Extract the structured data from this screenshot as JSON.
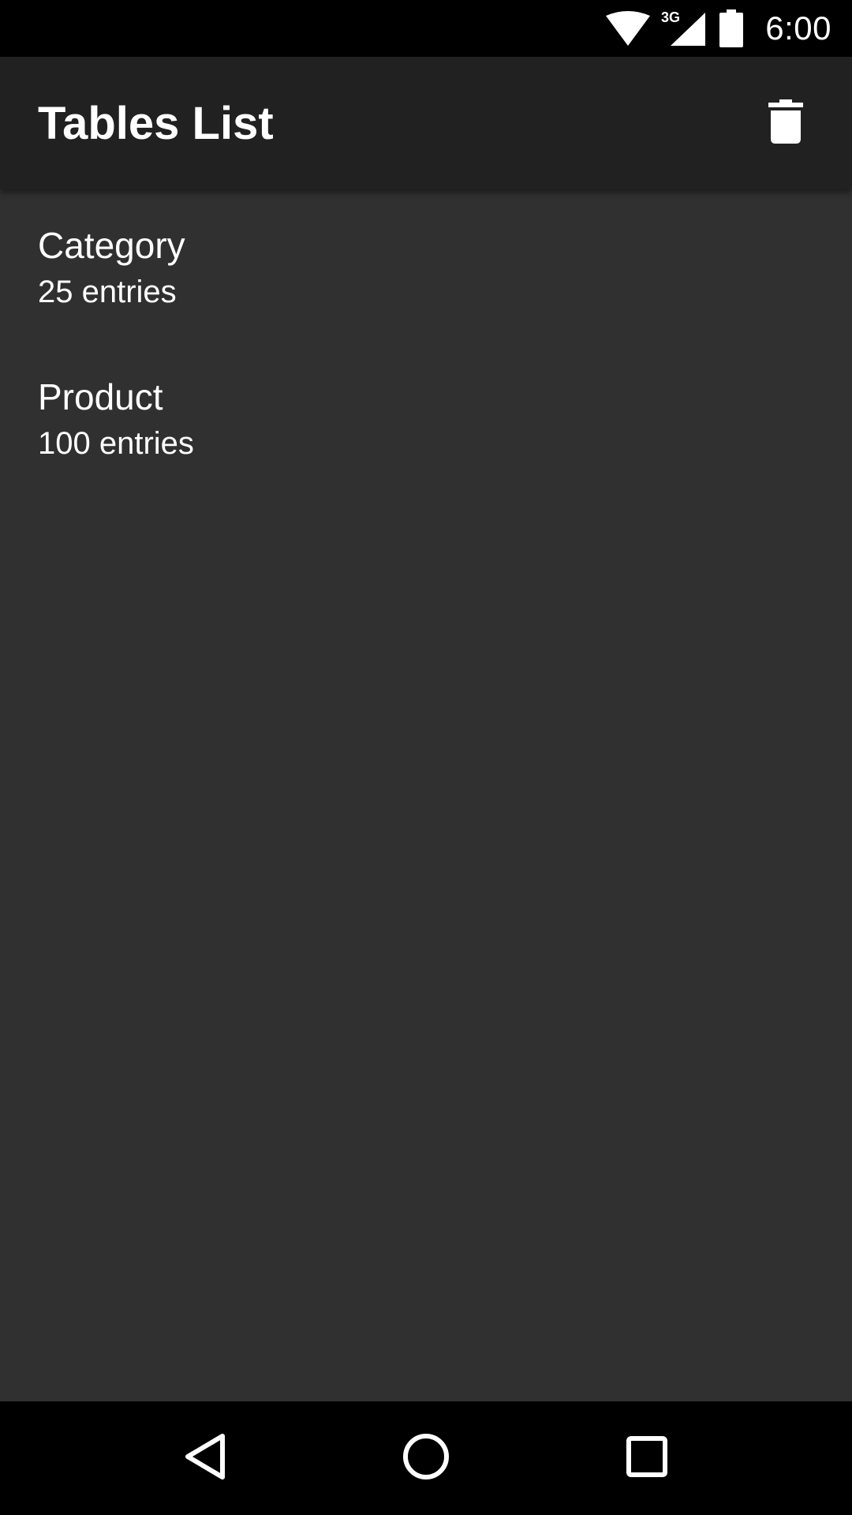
{
  "status_bar": {
    "time": "6:00",
    "network_label": "3G",
    "icons": [
      "wifi-icon",
      "cell-signal-icon",
      "battery-icon"
    ]
  },
  "app_bar": {
    "title": "Tables List",
    "action_icon": "delete-icon"
  },
  "tables": [
    {
      "name": "Category",
      "entries": "25 entries"
    },
    {
      "name": "Product",
      "entries": "100 entries"
    }
  ],
  "nav_bar": {
    "icons": [
      "back-icon",
      "home-icon",
      "recents-icon"
    ]
  },
  "colors": {
    "status_bar": "#000000",
    "app_bar": "#212121",
    "background": "#303030",
    "text": "#ffffff"
  }
}
